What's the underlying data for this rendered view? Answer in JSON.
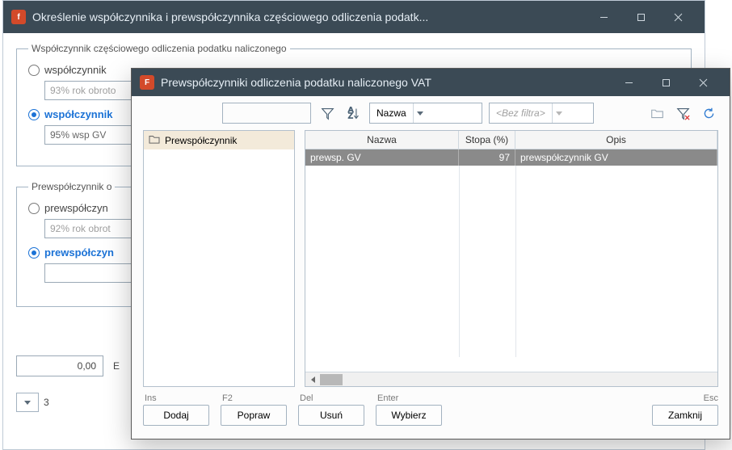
{
  "back_window": {
    "title": "Określenie współczynnika i prewspółczynnika częściowego odliczenia podatk...",
    "group1": {
      "legend": "Współczynnik częściowego odliczenia podatku naliczonego",
      "radio1_label": "współczynnik",
      "radio1_value": "93%  rok obroto",
      "radio2_label": "współczynnik",
      "radio2_value": "95%  wsp GV"
    },
    "group2": {
      "legend": "Prewspółczynnik o",
      "radio1_label": "prewspółczyn",
      "radio1_value": "92%  rok obrot",
      "radio2_label": "prewspółczyn",
      "radio2_value": ""
    },
    "num_value": "0,00",
    "letter_E": "E",
    "tiny_combo_value": "3"
  },
  "front_window": {
    "title": "Prewspółczynniki odliczenia podatku naliczonego VAT",
    "toolbar": {
      "search_value": "",
      "sort_field": "Nazwa",
      "filter_placeholder": "<Bez filtra>"
    },
    "tree_root": "Prewspółczynnik",
    "grid": {
      "columns": {
        "c1": "Nazwa",
        "c2": "Stopa (%)",
        "c3": "Opis"
      },
      "rows": [
        {
          "nazwa": "prewsp. GV",
          "stopa": "97",
          "opis": "prewspółczynnik GV"
        }
      ]
    },
    "footer": {
      "ins": "Ins",
      "dodaj": "Dodaj",
      "f2": "F2",
      "popraw": "Popraw",
      "del": "Del",
      "usun": "Usuń",
      "enter": "Enter",
      "wybierz": "Wybierz",
      "esc": "Esc",
      "zamknij": "Zamknij"
    }
  }
}
